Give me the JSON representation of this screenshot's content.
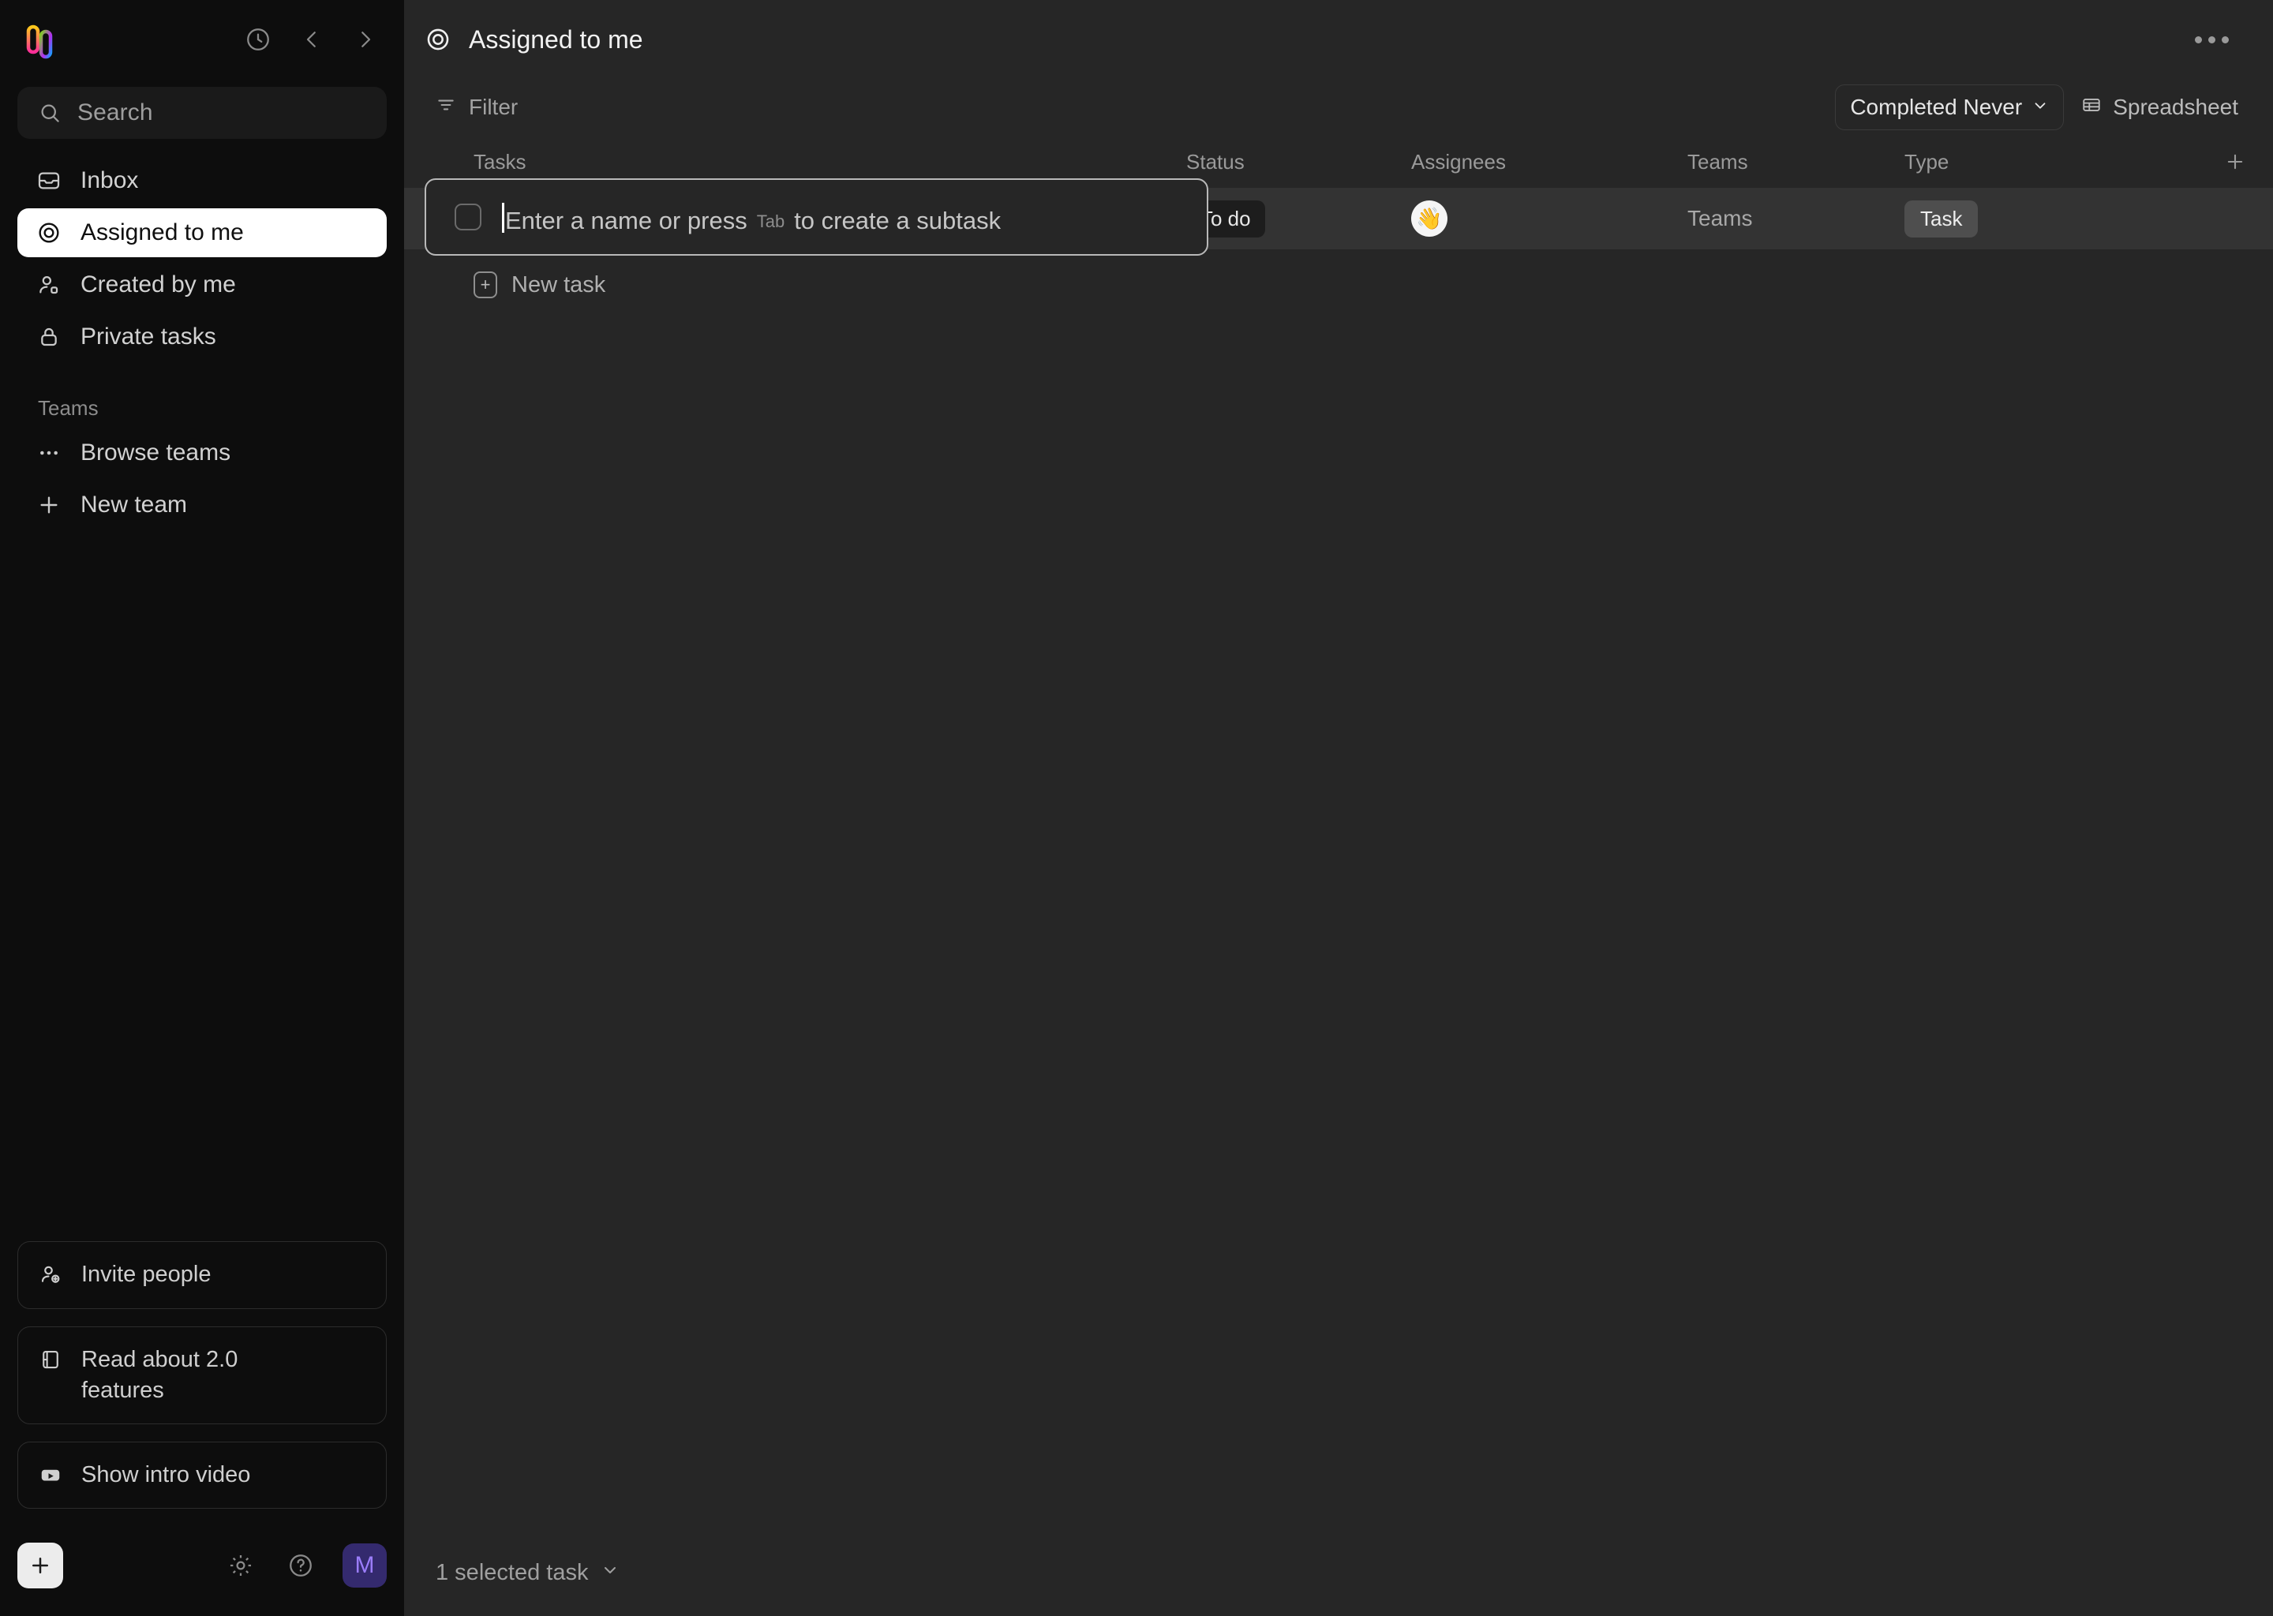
{
  "app": {
    "logo_name": "height-logo",
    "accent_purple": "#9b7dfb",
    "avatar_bg": "#342a6e",
    "sidebar_bg": "#0d0d0d",
    "main_bg": "#262626",
    "row_highlight_bg": "#333333"
  },
  "sidebar": {
    "history_icon": "clock-icon",
    "back_icon": "chevron-left-icon",
    "forward_icon": "chevron-right-icon",
    "search": {
      "placeholder": "Search",
      "icon": "search-icon"
    },
    "nav": [
      {
        "label": "Inbox",
        "icon": "inbox-icon",
        "active": false
      },
      {
        "label": "Assigned to me",
        "icon": "target-icon",
        "active": true
      },
      {
        "label": "Created by me",
        "icon": "user-icon",
        "active": false
      },
      {
        "label": "Private tasks",
        "icon": "lock-icon",
        "active": false
      }
    ],
    "teams_section": {
      "label": "Teams",
      "items": [
        {
          "label": "Browse teams",
          "icon": "ellipsis-icon"
        },
        {
          "label": "New team",
          "icon": "plus-icon"
        }
      ]
    },
    "cards": [
      {
        "label": "Invite people",
        "icon": "user-plus-icon"
      },
      {
        "label": "Read about 2.0 features",
        "icon": "book-icon"
      },
      {
        "label": "Show intro video",
        "icon": "video-icon"
      }
    ],
    "bottom": {
      "create_label": "+",
      "settings_icon": "gear-icon",
      "help_icon": "help-circle-icon",
      "avatar_initial": "M"
    }
  },
  "main": {
    "header": {
      "icon": "target-icon",
      "title": "Assigned to me",
      "more_icon": "ellipsis-icon"
    },
    "toolbar": {
      "filter_label": "Filter",
      "filter_icon": "filter-icon",
      "completed_label": "Completed Never",
      "completed_chevron": "chevron-down-icon",
      "view_label": "Spreadsheet",
      "view_icon": "spreadsheet-icon"
    },
    "columns": [
      {
        "key": "tasks",
        "label": "Tasks"
      },
      {
        "key": "status",
        "label": "Status"
      },
      {
        "key": "assignees",
        "label": "Assignees"
      },
      {
        "key": "teams",
        "label": "Teams"
      },
      {
        "key": "type",
        "label": "Type"
      }
    ],
    "add_column_icon": "plus-icon",
    "task_row": {
      "input_placeholder": "Enter a name or press",
      "input_key_hint": "Tab",
      "input_placeholder_tail": "to create a subtask",
      "checkbox_checked": false,
      "status": "To do",
      "assignee_emoji": "👋",
      "teams": "Teams",
      "type": "Task"
    },
    "new_task_label": "New task",
    "new_task_icon": "plus-square-icon",
    "status_bar": {
      "selected_label": "1 selected task",
      "chevron": "chevron-down-icon"
    }
  }
}
